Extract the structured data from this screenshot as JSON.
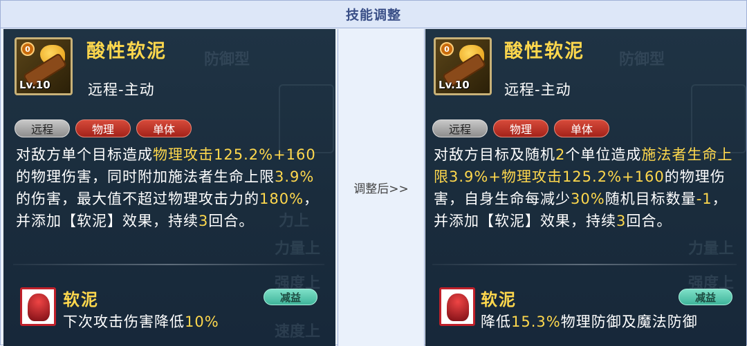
{
  "header": {
    "title": "技能调整"
  },
  "middle": {
    "label": "调整后>>"
  },
  "before": {
    "skill": {
      "name": "酸性软泥",
      "type": "远程-主动",
      "level": "Lv.10",
      "rank_badge": "0"
    },
    "tags": [
      {
        "label": "远程",
        "color": "gray"
      },
      {
        "label": "物理",
        "color": "red"
      },
      {
        "label": "单体",
        "color": "red"
      }
    ],
    "description_segments": [
      {
        "text": "对敌方单个目标造成",
        "highlight": false
      },
      {
        "text": "物理攻击125.2%+160",
        "highlight": true
      },
      {
        "text": "的物理伤害，同时附加施法者生命上限",
        "highlight": false
      },
      {
        "text": "3.9%",
        "highlight": true
      },
      {
        "text": "的伤害，最大值不超过物理攻击力的",
        "highlight": false
      },
      {
        "text": "180%",
        "highlight": true
      },
      {
        "text": "，并添加【软泥】效果，持续",
        "highlight": false
      },
      {
        "text": "3",
        "highlight": true
      },
      {
        "text": "回合。",
        "highlight": false
      }
    ],
    "effect": {
      "name": "软泥",
      "badge": "减益",
      "desc_segments": [
        {
          "text": "下次攻击伤害降低",
          "highlight": false
        },
        {
          "text": "10%",
          "highlight": true
        }
      ]
    }
  },
  "after": {
    "skill": {
      "name": "酸性软泥",
      "type": "远程-主动",
      "level": "Lv.10",
      "rank_badge": "0"
    },
    "tags": [
      {
        "label": "远程",
        "color": "gray"
      },
      {
        "label": "物理",
        "color": "red"
      },
      {
        "label": "单体",
        "color": "red"
      }
    ],
    "description_segments": [
      {
        "text": "对敌方目标及随机",
        "highlight": false
      },
      {
        "text": "2",
        "highlight": true
      },
      {
        "text": "个单位造成",
        "highlight": false
      },
      {
        "text": "施法者生命上限3.9%+物理攻击125.2%+160",
        "highlight": true
      },
      {
        "text": "的物理伤害，自身生命每减少",
        "highlight": false
      },
      {
        "text": "30%",
        "highlight": true
      },
      {
        "text": "随机目标数量",
        "highlight": false
      },
      {
        "text": "-1",
        "highlight": true
      },
      {
        "text": "，并添加【软泥】效果，持续",
        "highlight": false
      },
      {
        "text": "3",
        "highlight": true
      },
      {
        "text": "回合。",
        "highlight": false
      }
    ],
    "effect": {
      "name": "软泥",
      "badge": "减益",
      "desc_segments": [
        {
          "text": "降低",
          "highlight": false
        },
        {
          "text": "15.3%",
          "highlight": true
        },
        {
          "text": "物理防御及魔法防御",
          "highlight": false
        }
      ]
    }
  },
  "colors": {
    "highlight": "#ffd84d",
    "panel_bg": "#1c2f40",
    "header_text": "#3a4f87",
    "debuff_badge": "#5fcab0",
    "tag_red": "#b8302a",
    "tag_gray": "#a8a8a8"
  }
}
